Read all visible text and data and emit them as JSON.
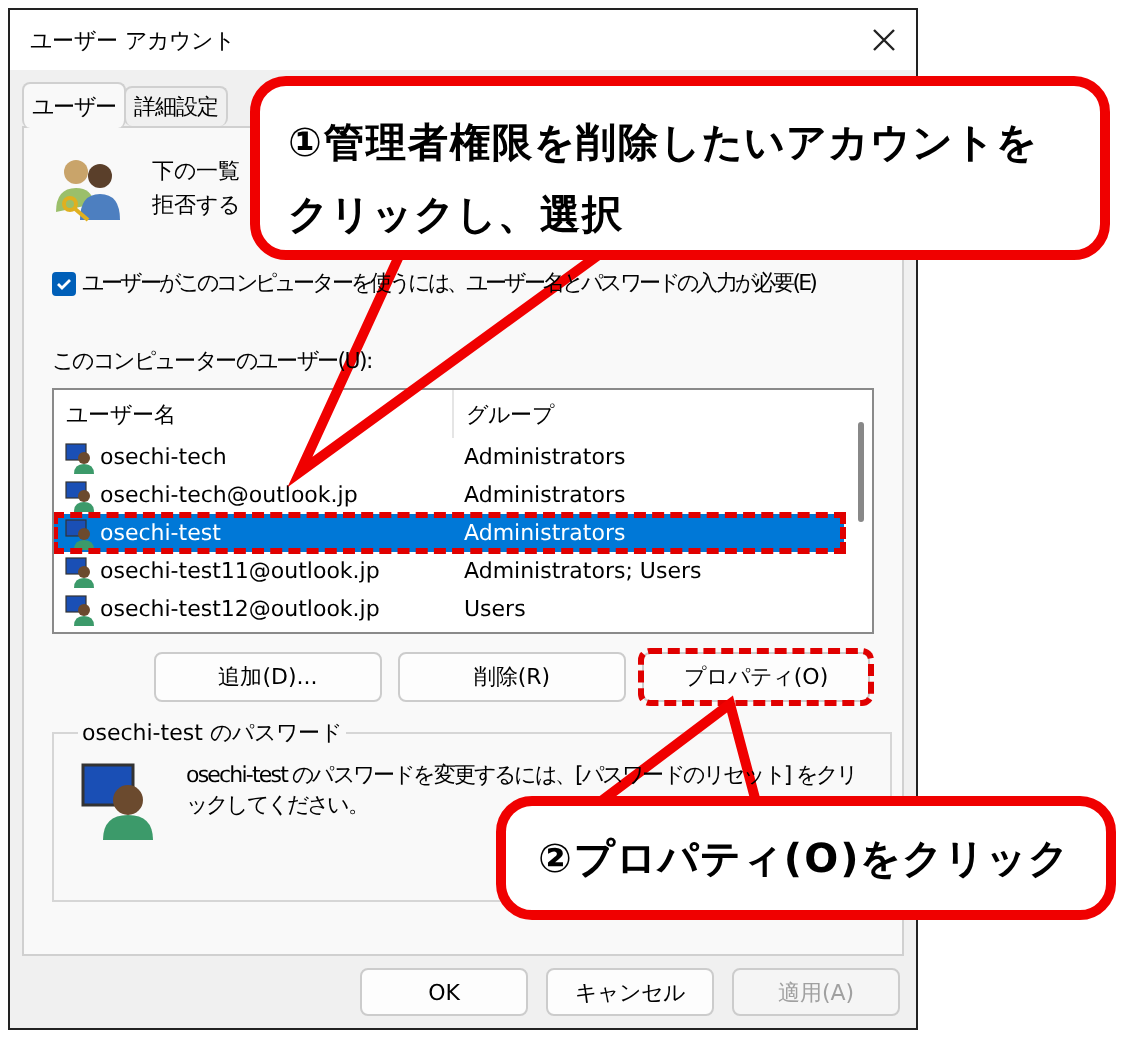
{
  "window": {
    "title": "ユーザー アカウント"
  },
  "tabs": [
    {
      "label": "ユーザー",
      "selected": true
    },
    {
      "label": "詳細設定",
      "selected": false
    }
  ],
  "description_lines": [
    "下の一覧",
    "拒否する"
  ],
  "require_password": {
    "label": "ユーザーがこのコンピューターを使うには、ユーザー名とパスワードの入力が必要(E)",
    "checked": true
  },
  "users_label": "このコンピューターのユーザー(U):",
  "table": {
    "columns": [
      "ユーザー名",
      "グループ"
    ],
    "rows": [
      {
        "name": "osechi-tech",
        "group": "Administrators",
        "selected": false,
        "marked": false
      },
      {
        "name": "osechi-tech@outlook.jp",
        "group": "Administrators",
        "selected": false,
        "marked": false
      },
      {
        "name": "osechi-test",
        "group": "Administrators",
        "selected": true,
        "marked": true
      },
      {
        "name": "osechi-test11@outlook.jp",
        "group": "Administrators; Users",
        "selected": false,
        "marked": false
      },
      {
        "name": "osechi-test12@outlook.jp",
        "group": "Users",
        "selected": false,
        "marked": false
      }
    ]
  },
  "list_buttons": [
    {
      "label": "追加(D)...",
      "marked": false
    },
    {
      "label": "削除(R)",
      "marked": false
    },
    {
      "label": "プロパティ(O)",
      "marked": true
    }
  ],
  "password_group": {
    "title": "osechi-test のパスワード",
    "text": "osechi-test のパスワードを変更するには、[パスワードのリセット] をクリックしてください。"
  },
  "footer_buttons": [
    {
      "label": "OK",
      "disabled": false
    },
    {
      "label": "キャンセル",
      "disabled": false
    },
    {
      "label": "適用(A)",
      "disabled": true
    }
  ],
  "callouts": [
    {
      "text": "①管理者権限を削除したいアカウントをクリックし、選択"
    },
    {
      "text": "②プロパティ(O)をクリック"
    }
  ]
}
